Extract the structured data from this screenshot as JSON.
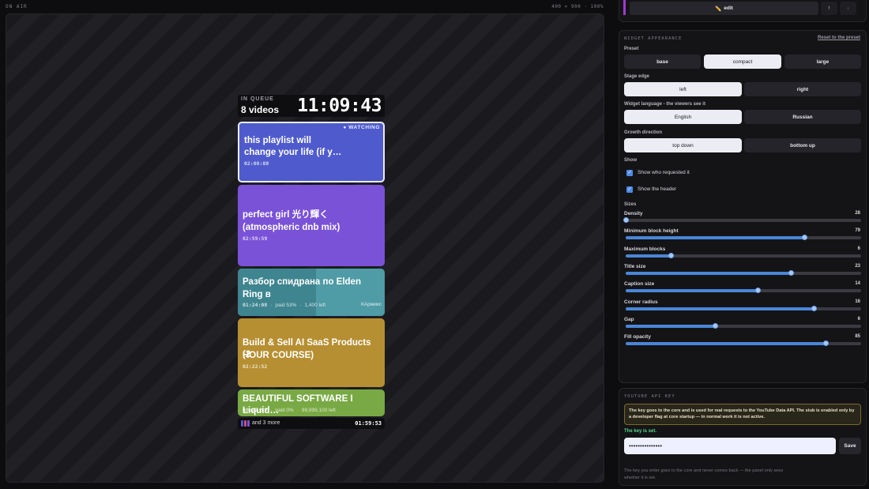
{
  "preview": {
    "on_air": "ON AIR",
    "dims": "400 × 900 · 100%",
    "widget": {
      "queue_label": "IN QUEUE",
      "queue_count": "8 videos",
      "total_time": "11:09:43",
      "cards": [
        {
          "title_l1": "this playlist will",
          "title_l2": "change your life (if y…",
          "meta": "02:08:08",
          "badge": "● WATCHING",
          "color": "#4f5bcc"
        },
        {
          "title_l1": "perfect girl 光り輝く",
          "title_l2": "(atmospheric dnb mix)",
          "meta": "02:59:59",
          "color": "#7a52d8"
        },
        {
          "title_l1": "Разбор спидрана по Elden",
          "title_l2": "Ring в",
          "time": "01:24:08",
          "paid": "paid 53%",
          "left": "1,400 left",
          "requested_by": "КАрмикс",
          "paid_fraction": 0.53,
          "color": "#4f9ba6"
        },
        {
          "title_l1": "Build & Sell AI SaaS Products (2",
          "title_l2": "HOUR COURSE)",
          "meta": "02:22:52",
          "color": "#b68f32"
        },
        {
          "title_l1": "BEAUTIFUL SOFTWARE I Liquid…",
          "time": "08:22:59",
          "paid": "paid 0%",
          "left": "99,999,100 left",
          "color": "#79a944"
        }
      ],
      "footer_more": "and 3 more",
      "footer_time": "01:59:53",
      "footer_dot_colors": [
        "#4f5bcc",
        "#d04a8c",
        "#7a52d8"
      ]
    }
  },
  "panel": {
    "top": {
      "edit": "edit",
      "up": "↑",
      "down": "↓",
      "accent": "#a13ad0"
    },
    "appearance": {
      "title": "WIDGET APPEARANCE",
      "reset": "Reset to the preset",
      "preset_label": "Preset",
      "preset_options": [
        "base",
        "compact",
        "large"
      ],
      "preset_selected": "compact",
      "edge_label": "Stage edge",
      "edge_options": [
        "left",
        "right"
      ],
      "edge_selected": "left",
      "lang_label": "Widget language - the viewers see it",
      "lang_options": [
        "English",
        "Russian"
      ],
      "lang_selected": "English",
      "growth_label": "Growth direction",
      "growth_options": [
        "top down",
        "bottom up"
      ],
      "growth_selected": "top down",
      "show_label": "Show",
      "show_requested": "Show who requested it",
      "show_header": "Show the header",
      "sizes_label": "Sizes",
      "sliders": [
        {
          "name": "Density",
          "value": "28",
          "fraction": 0.0
        },
        {
          "name": "Minimum block height",
          "value": "79",
          "fraction": 0.76
        },
        {
          "name": "Maximum blocks",
          "value": "6",
          "fraction": 0.19
        },
        {
          "name": "Title size",
          "value": "23",
          "fraction": 0.7
        },
        {
          "name": "Caption size",
          "value": "14",
          "fraction": 0.56
        },
        {
          "name": "Corner radius",
          "value": "16",
          "fraction": 0.8
        },
        {
          "name": "Gap",
          "value": "6",
          "fraction": 0.38
        },
        {
          "name": "Fill opacity",
          "value": "85",
          "fraction": 0.85
        }
      ]
    },
    "api": {
      "title": "YOUTUBE API KEY",
      "warning": "The key goes to the core and is used for real requests to the YouTube Data API. The stub is enabled only by a developer flag at core startup — in normal work it is not active.",
      "status": "The key is set.",
      "key_value": "•••••••••••••••",
      "save": "Save",
      "note": "The key you enter goes to the core and never comes back — the panel only sees whether it is set."
    }
  }
}
